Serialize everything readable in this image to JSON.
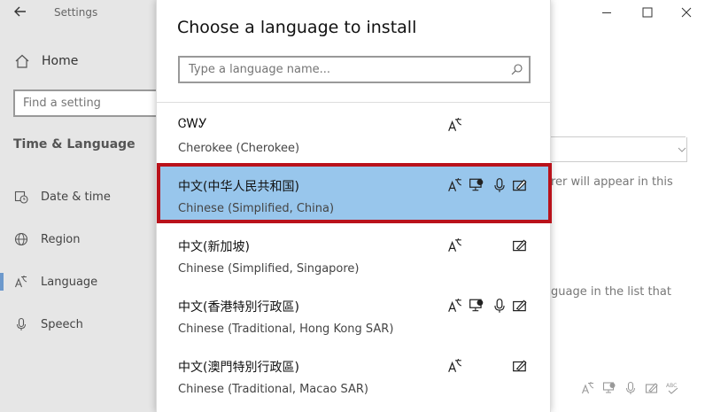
{
  "app": {
    "title": "Settings"
  },
  "sidebar": {
    "home_label": "Home",
    "search_placeholder": "Find a setting",
    "section_title": "Time & Language",
    "items": [
      {
        "label": "Date & time",
        "icon": "calendar-clock-icon"
      },
      {
        "label": "Region",
        "icon": "globe-icon"
      },
      {
        "label": "Language",
        "icon": "language-icon",
        "active": true
      },
      {
        "label": "Speech",
        "icon": "microphone-icon"
      }
    ]
  },
  "background_text": {
    "line1": "rer will appear in this",
    "line2": "guage in the list that"
  },
  "dialog": {
    "title": "Choose a language to install",
    "search_placeholder": "Type a language name...",
    "languages": [
      {
        "native": "ᏣᎳᎩ",
        "name": "Cherokee (Cherokee)",
        "features": [
          "display-language"
        ]
      },
      {
        "native": "中文(中华人民共和国)",
        "name": "Chinese (Simplified, China)",
        "features": [
          "display-language",
          "text-to-speech",
          "speech-recognition",
          "handwriting"
        ],
        "selected": true
      },
      {
        "native": "中文(新加坡)",
        "name": "Chinese (Simplified, Singapore)",
        "features": [
          "display-language",
          "handwriting"
        ]
      },
      {
        "native": "中文(香港特別行政區)",
        "name": "Chinese (Traditional, Hong Kong SAR)",
        "features": [
          "display-language",
          "text-to-speech",
          "speech-recognition",
          "handwriting"
        ]
      },
      {
        "native": "中文(澳門特別行政區)",
        "name": "Chinese (Traditional, Macao SAR)",
        "features": [
          "display-language",
          "handwriting"
        ]
      }
    ]
  },
  "colors": {
    "selected_bg": "#98c6ec",
    "selected_border": "#b9121b",
    "sidebar_bg": "#e6e6e6"
  }
}
